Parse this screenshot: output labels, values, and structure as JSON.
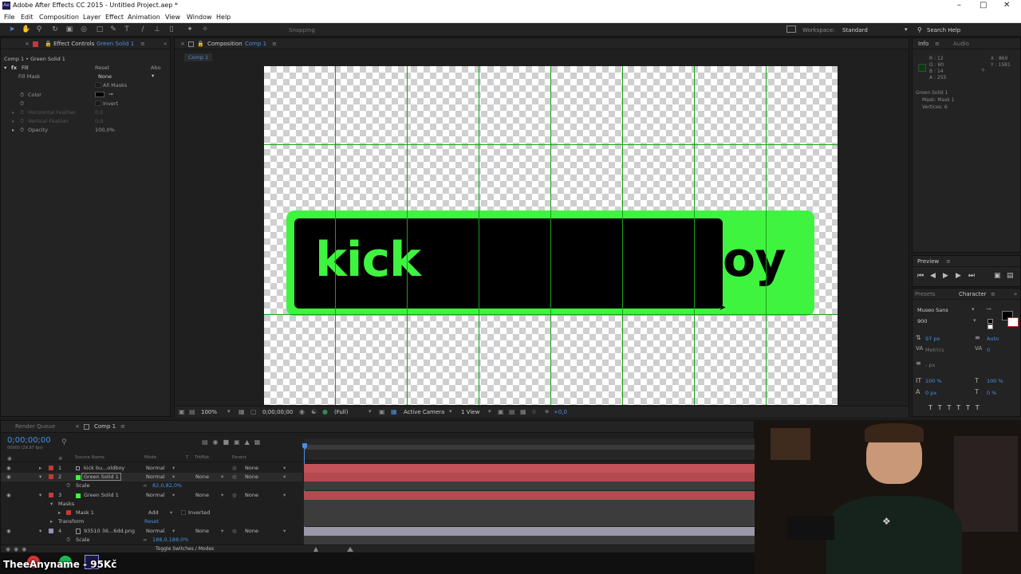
{
  "window": {
    "title": "Adobe After Effects CC 2015 - Untitled Project.aep *",
    "app_icon": "Ae"
  },
  "menu": [
    "File",
    "Edit",
    "Composition",
    "Layer",
    "Effect",
    "Animation",
    "View",
    "Window",
    "Help"
  ],
  "toolbar": {
    "snapping": "Snapping",
    "workspace_label": "Workspace:",
    "workspace_value": "Standard",
    "search_help": "Search Help"
  },
  "effect_controls": {
    "tab_prefix": "Effect Controls",
    "tab_layer": "Green Solid 1",
    "breadcrumb": "Comp 1 • Green Solid 1",
    "effect_name": "Fill",
    "reset": "Reset",
    "about": "Abo",
    "props": [
      {
        "label": "Fill Mask",
        "value": "None"
      },
      {
        "label": "",
        "value": "All Masks"
      },
      {
        "label": "Color",
        "value": ""
      },
      {
        "label": "",
        "value": "Invert"
      },
      {
        "label": "Horizontal Feather",
        "value": "0,0"
      },
      {
        "label": "Vertical Feather",
        "value": "0,0"
      },
      {
        "label": "Opacity",
        "value": "100,0%"
      }
    ],
    "fill_color": "#000000"
  },
  "composition": {
    "tab_prefix": "Composition",
    "tab_name": "Comp 1",
    "sub_tab": "Comp 1",
    "text_left": "kick",
    "text_right": "oy",
    "green": "#3ff43f",
    "footer": {
      "zoom": "100%",
      "timecode": "0;00;00;00",
      "resolution": "(Full)",
      "camera": "Active Camera",
      "view": "1 View",
      "offset": "+0,0"
    }
  },
  "info": {
    "tab": "Info",
    "tab2": "Audio",
    "rgb": [
      "R : 12",
      "G : 60",
      "B : 14",
      "A : 255"
    ],
    "xy": [
      "X : 860",
      "Y : 1581"
    ],
    "lines": [
      "Green Solid 1",
      "Mask: Mask 1",
      "Vertices: 6"
    ],
    "swatch": "#0c3c0e"
  },
  "preview": {
    "tab": "Preview"
  },
  "character": {
    "tab_presets": "Presets",
    "tab": "Character",
    "font": "Museo Sans",
    "weight": "900",
    "size": "97 px",
    "leading": "Auto",
    "kerning": "Metrics",
    "tracking": "0",
    "stroke": "- px",
    "vscale": "100 %",
    "hscale": "100 %",
    "baseline": "0 px",
    "tsume": "0 %"
  },
  "timeline": {
    "tab_render": "Render Queue",
    "tab_comp": "Comp 1",
    "timecode": "0;00;00;00",
    "fps": "00000 (29.97 fps)",
    "headers": [
      "#",
      "Source Name",
      "Mode",
      "T",
      "TrkMat",
      "Parent"
    ],
    "layers": [
      {
        "num": "1",
        "name": "kick bu...oldboy",
        "mode": "Normal",
        "trkmat": "",
        "parent": "None",
        "label": "#c23a3a",
        "bar": "#c4525a",
        "type": "layer"
      },
      {
        "num": "2",
        "name": "Green Solid 1",
        "mode": "Normal",
        "trkmat": "None",
        "parent": "None",
        "label": "#c23a3a",
        "bar": "#b44a50",
        "type": "layer"
      },
      {
        "num": "",
        "name": "Scale",
        "mode": "",
        "trkmat": "",
        "parent": "",
        "value": "82,0,82,0%",
        "bar": "#3c3c3c",
        "type": "prop"
      },
      {
        "num": "3",
        "name": "Green Solid 1",
        "mode": "Normal",
        "trkmat": "None",
        "parent": "None",
        "label": "#c23a3a",
        "bar": "#b44a50",
        "type": "layer"
      },
      {
        "num": "",
        "name": "Masks",
        "mode": "",
        "trkmat": "",
        "parent": "",
        "bar": "#3c3c3c",
        "type": "prop"
      },
      {
        "num": "",
        "name": "Mask 1",
        "mode": "Add",
        "trkmat": "Inverted",
        "parent": "",
        "bar": "#3c3c3c",
        "type": "prop"
      },
      {
        "num": "",
        "name": "Transform",
        "mode": "Reset",
        "trkmat": "",
        "parent": "",
        "bar": "#3c3c3c",
        "type": "prop"
      },
      {
        "num": "4",
        "name": "93510 36...6dd.png",
        "mode": "Normal",
        "trkmat": "None",
        "parent": "None",
        "label": "#9a8fb8",
        "bar": "#9a98a8",
        "type": "layer"
      },
      {
        "num": "",
        "name": "Scale",
        "mode": "",
        "trkmat": "",
        "parent": "",
        "value": "188,0,188,0%",
        "bar": "#3c3c3c",
        "type": "prop"
      }
    ],
    "toggle_label": "Toggle Switches / Modes"
  },
  "streamer": {
    "name": "TheeAnyname - 95Kč"
  }
}
